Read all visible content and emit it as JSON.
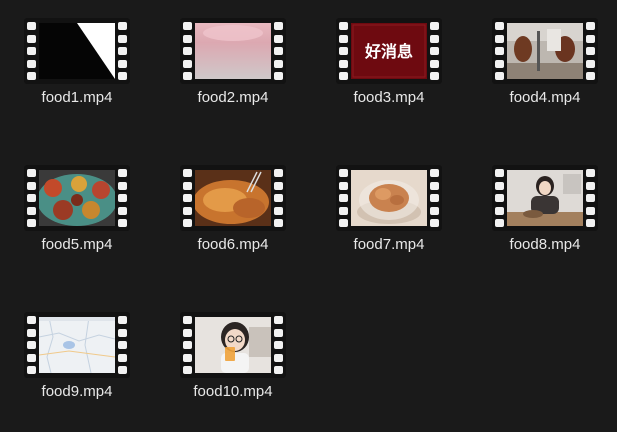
{
  "files": [
    {
      "name": "food1.mp4",
      "thumb": "diagonal-black-white"
    },
    {
      "name": "food2.mp4",
      "thumb": "pink-blur"
    },
    {
      "name": "food3.mp4",
      "thumb": "red-title-card",
      "thumb_text": "好消息"
    },
    {
      "name": "food4.mp4",
      "thumb": "kitchen-roasts"
    },
    {
      "name": "food5.mp4",
      "thumb": "colorful-platter"
    },
    {
      "name": "food6.mp4",
      "thumb": "fried-dough"
    },
    {
      "name": "food7.mp4",
      "thumb": "bowl-of-shrimp"
    },
    {
      "name": "food8.mp4",
      "thumb": "woman-in-kitchen"
    },
    {
      "name": "food9.mp4",
      "thumb": "map-screenshot"
    },
    {
      "name": "food10.mp4",
      "thumb": "woman-with-drink"
    }
  ],
  "colors": {
    "background": "#1a1a1a",
    "text": "#e8e8e8",
    "sprocket": "#f2f2f2",
    "film": "#121212"
  }
}
